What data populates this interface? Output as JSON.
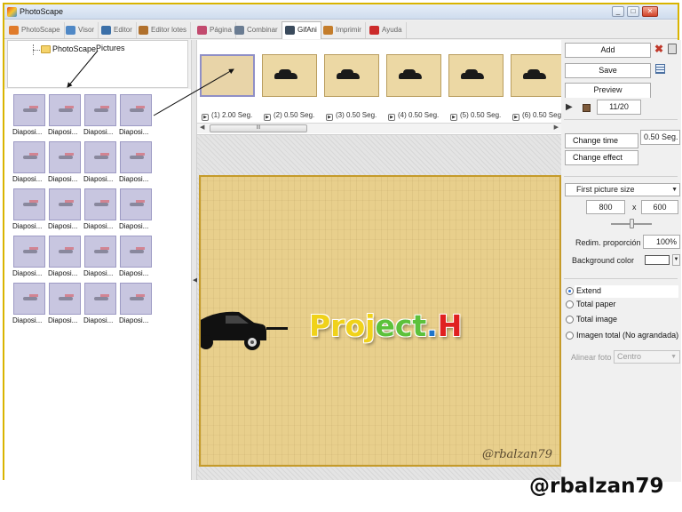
{
  "window": {
    "title": "PhotoScape",
    "controls": [
      "_",
      "□",
      "✕"
    ]
  },
  "tabs": [
    {
      "label": "PhotoScape",
      "color": "#e07b2a",
      "active": false
    },
    {
      "label": "Visor",
      "color": "#4f88c6",
      "active": false
    },
    {
      "label": "Editor",
      "color": "#3b6fa8",
      "active": false
    },
    {
      "label": "Editor lotes",
      "color": "#b0702c",
      "active": false
    },
    {
      "label": "Página",
      "color": "#c24a6e",
      "active": false
    },
    {
      "label": "Combinar",
      "color": "#6a7c92",
      "active": false
    },
    {
      "label": "GifAni",
      "color": "#3a4a5c",
      "active": true
    },
    {
      "label": "Imprimir",
      "color": "#c47d2b",
      "active": false
    },
    {
      "label": "Ayuda",
      "color": "#cc2b2b",
      "active": false
    }
  ],
  "tree": {
    "root_label": "PhotoScape",
    "annotation_label": "Pictures"
  },
  "thumbnails": [
    "Diaposi...",
    "Diaposi...",
    "Diaposi...",
    "Diaposi...",
    "Diaposi...",
    "Diaposi...",
    "Diaposi...",
    "Diaposi...",
    "Diaposi...",
    "Diaposi...",
    "Diaposi...",
    "Diaposi...",
    "Diaposi...",
    "Diaposi...",
    "Diaposi...",
    "Diaposi...",
    "Diaposi...",
    "Diaposi...",
    "Diaposi...",
    "Diaposi..."
  ],
  "frames": [
    {
      "label": "(1) 2.00 Seg.",
      "selected": true
    },
    {
      "label": "(2) 0.50 Seg.",
      "selected": false
    },
    {
      "label": "(3) 0.50 Seg.",
      "selected": false
    },
    {
      "label": "(4) 0.50 Seg.",
      "selected": false
    },
    {
      "label": "(5) 0.50 Seg.",
      "selected": false
    },
    {
      "label": "(6) 0.50 Seg.",
      "selected": false
    }
  ],
  "scrollbar_grip": "III",
  "preview": {
    "title_parts": [
      "Proj",
      "ect",
      ".",
      "H"
    ],
    "title_colors": [
      "#f0d21a",
      "#5cc13b",
      "#1e74c9",
      "#e02020"
    ],
    "signature": "@rbalzan79"
  },
  "panel": {
    "add_label": "Add",
    "save_label": "Save",
    "preview_label": "Preview",
    "frame_counter": "11/20",
    "change_time_label": "Change time",
    "time_value": "0.50 Seg.",
    "change_effect_label": "Change effect",
    "size_option": "First picture size",
    "width": "800",
    "x_label": "x",
    "height": "600",
    "resize_label": "Redim. proporción",
    "resize_value": "100%",
    "bg_color_label": "Background color",
    "bg_color": "#ffffff",
    "radio_options": [
      {
        "label": "Extend",
        "checked": true
      },
      {
        "label": "Total paper",
        "checked": false
      },
      {
        "label": "Total image",
        "checked": false
      },
      {
        "label": "Imagen total (No agrandada)",
        "checked": false
      }
    ],
    "align_label": "Alinear foto",
    "align_value": "Centro"
  },
  "watermark": "@rbalzan79"
}
